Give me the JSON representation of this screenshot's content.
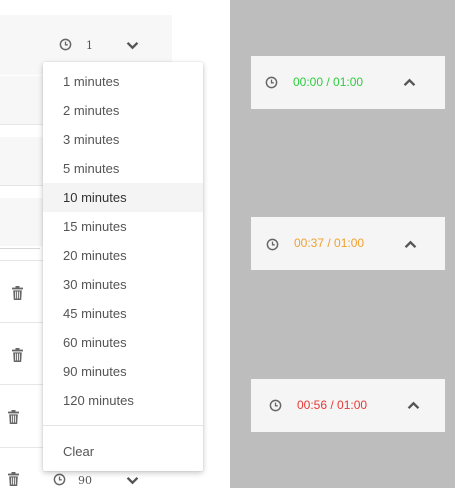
{
  "left": {
    "top_row": {
      "duration_value": "1"
    },
    "bottom_row": {
      "duration_value": "90"
    }
  },
  "dropdown": {
    "options": [
      "1 minutes",
      "2 minutes",
      "3 minutes",
      "5 minutes",
      "10 minutes",
      "15 minutes",
      "20 minutes",
      "30 minutes",
      "45 minutes",
      "60 minutes",
      "90 minutes",
      "120 minutes"
    ],
    "selected": "10 minutes",
    "clear_label": "Clear"
  },
  "timers": [
    {
      "elapsed": "00:00 / 01:00",
      "color": "#2ecc40"
    },
    {
      "elapsed": "00:37 / 01:00",
      "color": "#f0a030"
    },
    {
      "elapsed": "00:56 / 01:00",
      "color": "#e53935"
    }
  ],
  "colors": {
    "panel_gray": "#bdbdbd",
    "card_bg": "#f5f5f5",
    "icon_gray": "#666666"
  }
}
